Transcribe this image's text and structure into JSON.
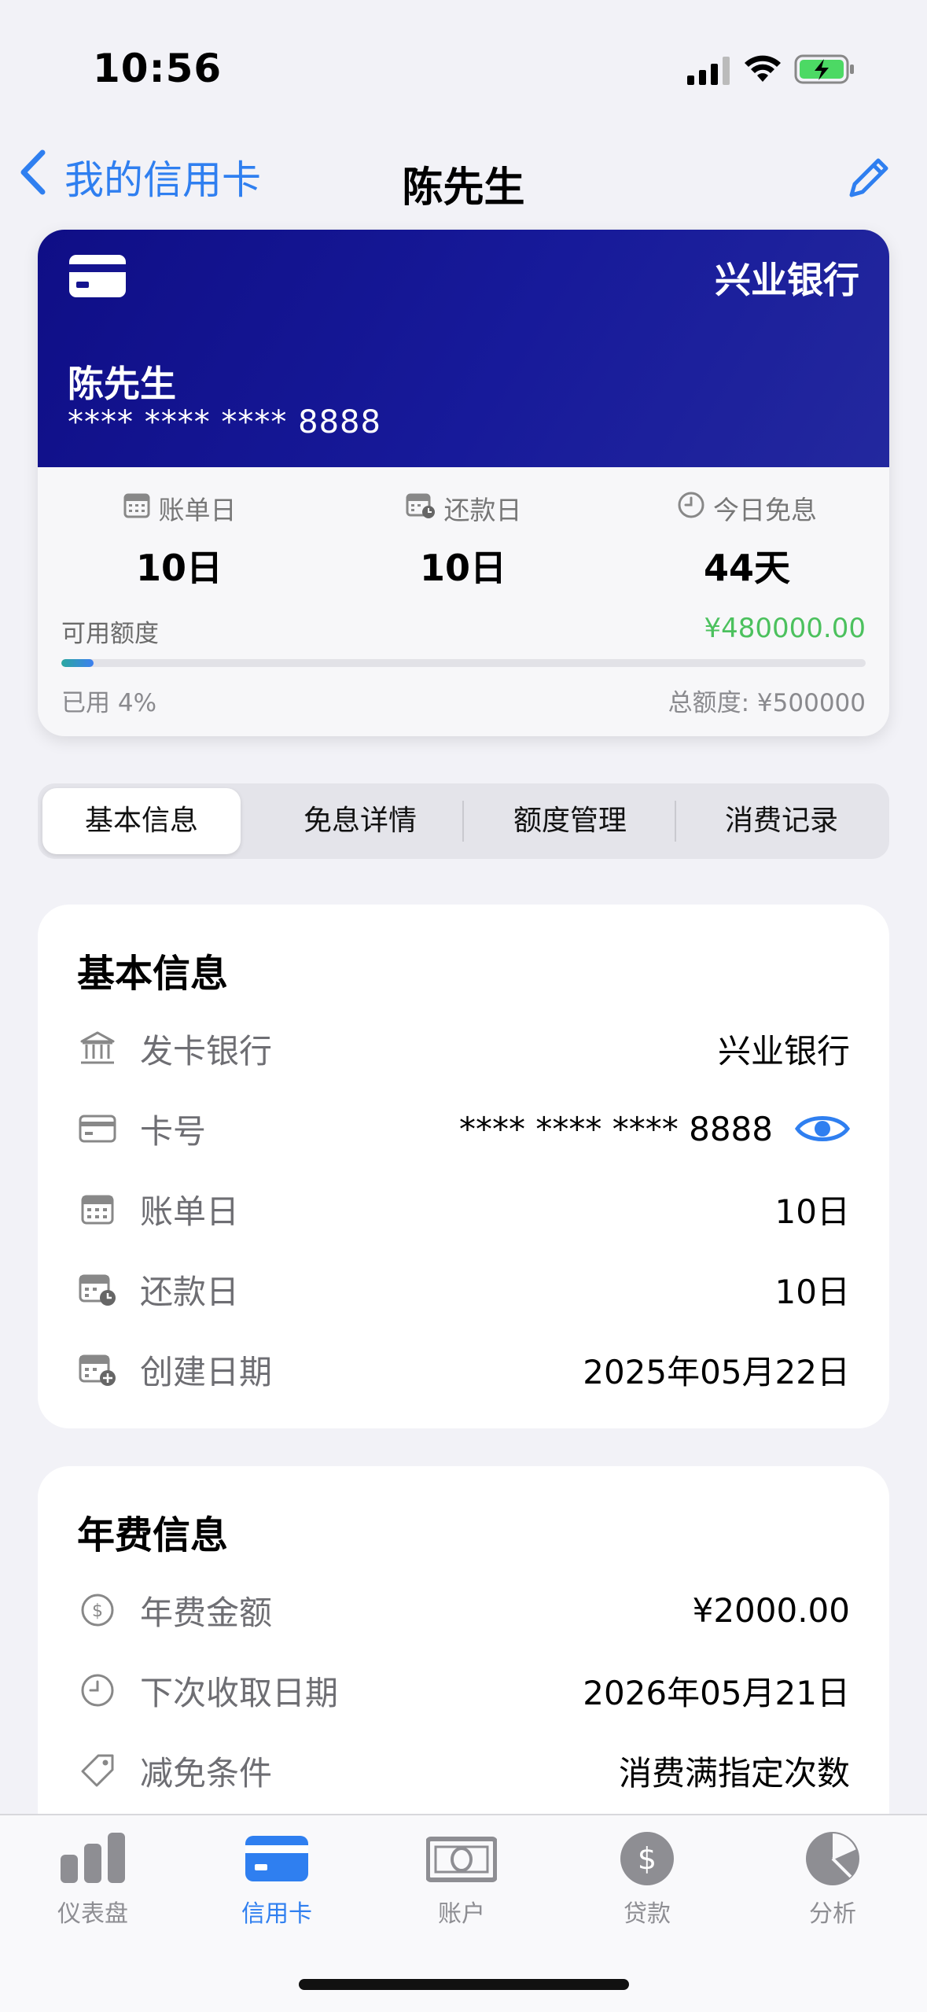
{
  "status_bar": {
    "time": "10:56"
  },
  "nav": {
    "back_label": "我的信用卡",
    "title": "陈先生"
  },
  "card": {
    "bank": "兴业银行",
    "holder": "陈先生",
    "number": "**** **** **** 8888",
    "stats": [
      {
        "label": "账单日",
        "value": "10日",
        "icon": "calendar-icon"
      },
      {
        "label": "还款日",
        "value": "10日",
        "icon": "calendar-clock-icon"
      },
      {
        "label": "今日免息",
        "value": "44天",
        "icon": "clock-icon"
      }
    ],
    "available_label": "可用额度",
    "available_value": "¥480000.00",
    "used_label": "已用 4%",
    "used_fraction": 0.04,
    "total_label": "总额度: ¥500000",
    "accent_green": "#4cc15e",
    "card_color": "#15148f"
  },
  "tabs": [
    "基本信息",
    "免息详情",
    "额度管理",
    "消费记录"
  ],
  "basic_info": {
    "title": "基本信息",
    "rows": [
      {
        "label": "发卡银行",
        "value": "兴业银行",
        "icon": "bank-icon"
      },
      {
        "label": "卡号",
        "value": "**** **** **** 8888",
        "icon": "card-icon"
      },
      {
        "label": "账单日",
        "value": "10日",
        "icon": "calendar-icon"
      },
      {
        "label": "还款日",
        "value": "10日",
        "icon": "calendar-clock-icon"
      },
      {
        "label": "创建日期",
        "value": "2025年05月22日",
        "icon": "calendar-plus-icon"
      }
    ]
  },
  "annual_fee": {
    "title": "年费信息",
    "rows": [
      {
        "label": "年费金额",
        "value": "¥2000.00",
        "icon": "dollar-circle-icon"
      },
      {
        "label": "下次收取日期",
        "value": "2026年05月21日",
        "icon": "clock-icon"
      },
      {
        "label": "减免条件",
        "value": "消费满指定次数",
        "icon": "tag-icon"
      }
    ]
  },
  "tabbar": {
    "items": [
      {
        "label": "仪表盘",
        "icon": "bar-chart-icon"
      },
      {
        "label": "信用卡",
        "icon": "credit-card-icon"
      },
      {
        "label": "账户",
        "icon": "banknote-icon"
      },
      {
        "label": "贷款",
        "icon": "dollar-circle-icon"
      },
      {
        "label": "分析",
        "icon": "pie-chart-icon"
      }
    ],
    "active_color": "#2f7ff0"
  }
}
